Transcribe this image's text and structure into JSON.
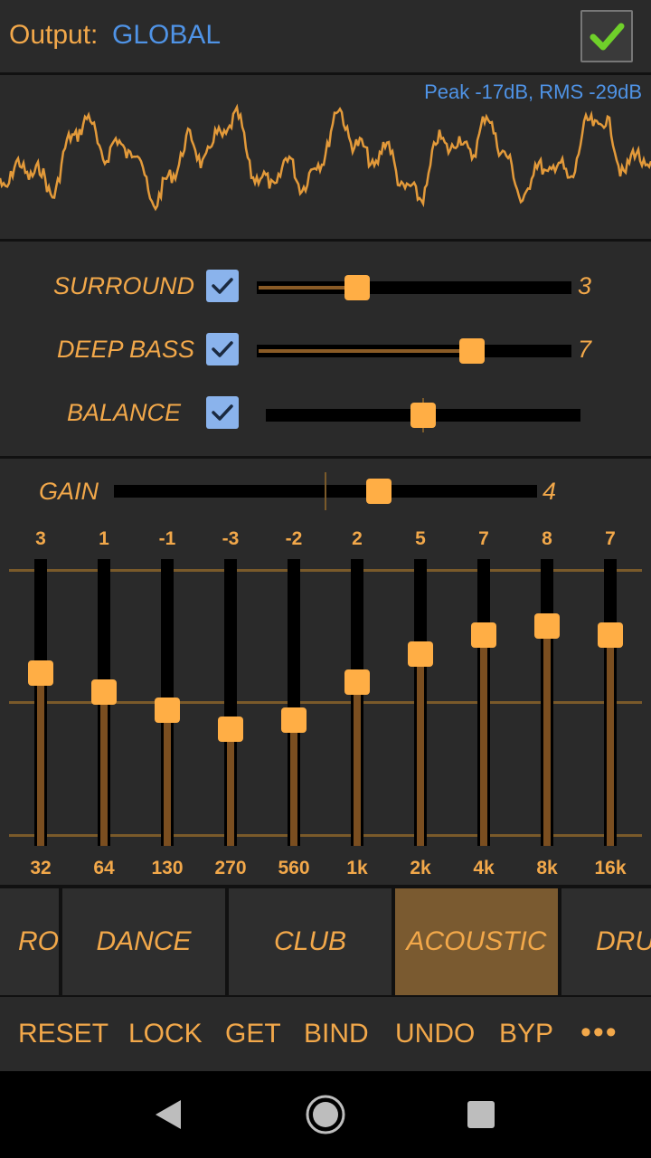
{
  "header": {
    "output_label": "Output:",
    "output_value": "GLOBAL"
  },
  "meter": {
    "peak_text": "Peak -17dB, RMS -29dB"
  },
  "effects": [
    {
      "label": "SURROUND",
      "checked": true,
      "value": "3",
      "level": 0.3
    },
    {
      "label": "DEEP BASS",
      "checked": true,
      "value": "7",
      "level": 0.7
    },
    {
      "label": "BALANCE",
      "checked": true,
      "value": "",
      "level": 0.5
    }
  ],
  "gain": {
    "label": "GAIN",
    "value": "4"
  },
  "eq": {
    "bands": [
      {
        "freq": "32",
        "value": "3"
      },
      {
        "freq": "64",
        "value": "1"
      },
      {
        "freq": "130",
        "value": "-1"
      },
      {
        "freq": "270",
        "value": "-3"
      },
      {
        "freq": "560",
        "value": "-2"
      },
      {
        "freq": "1k",
        "value": "2"
      },
      {
        "freq": "2k",
        "value": "5"
      },
      {
        "freq": "4k",
        "value": "7"
      },
      {
        "freq": "8k",
        "value": "8"
      },
      {
        "freq": "16k",
        "value": "7"
      }
    ]
  },
  "presets": {
    "items": [
      "RO",
      "DANCE",
      "CLUB",
      "ACOUSTIC",
      "DRU"
    ],
    "selected": "ACOUSTIC"
  },
  "toolbar": {
    "reset": "RESET",
    "lock": "LOCK",
    "get": "GET",
    "bind": "BIND",
    "undo": "UNDO",
    "byp": "BYP",
    "more": "•••"
  },
  "colors": {
    "accent": "#f2a84a",
    "thumb": "#ffae45",
    "blue": "#4f93e6",
    "selected_preset": "#7a5a30"
  }
}
